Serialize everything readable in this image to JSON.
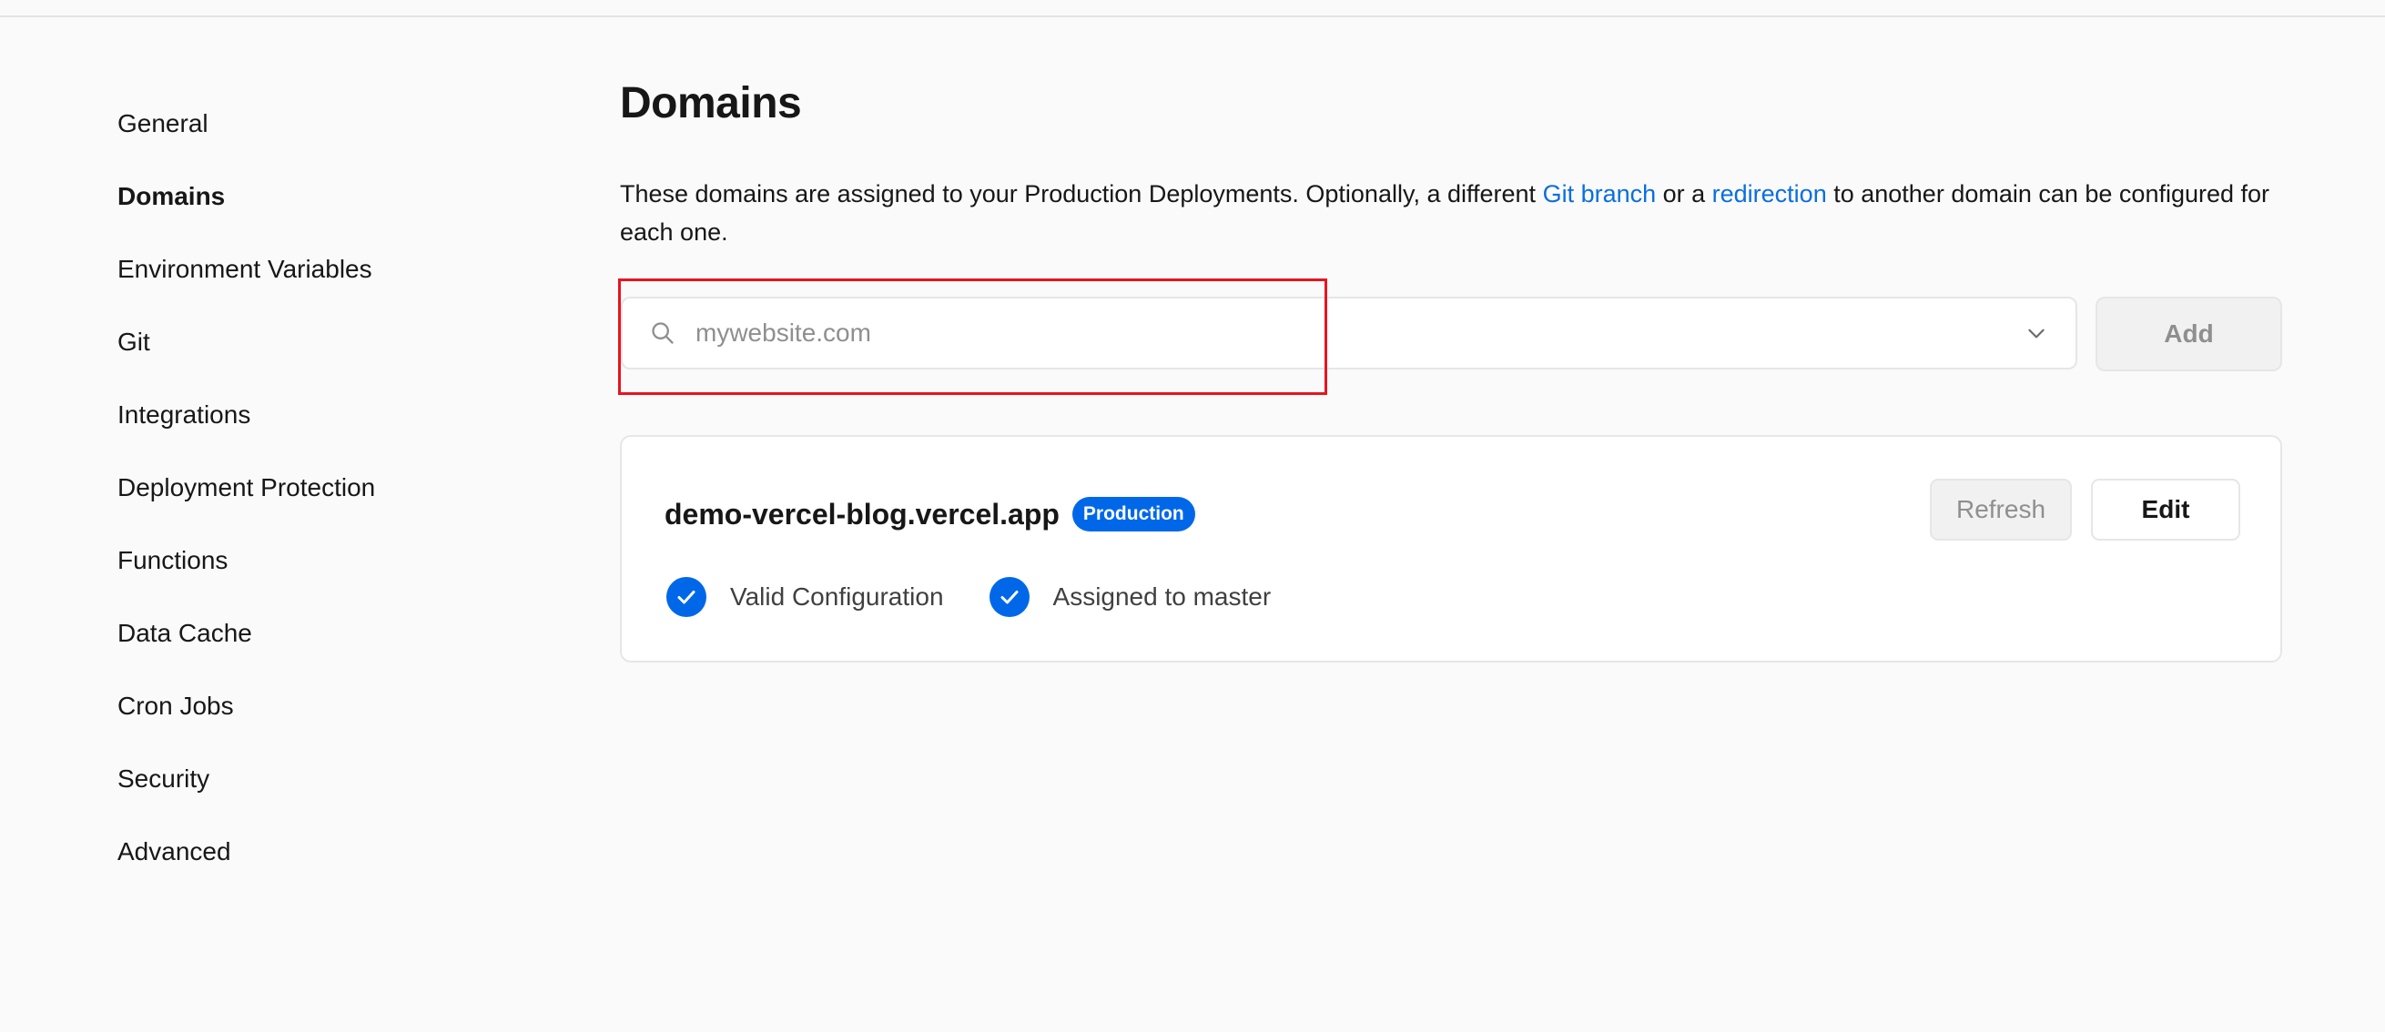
{
  "sidebar": {
    "items": [
      {
        "label": "General"
      },
      {
        "label": "Domains"
      },
      {
        "label": "Environment Variables"
      },
      {
        "label": "Git"
      },
      {
        "label": "Integrations"
      },
      {
        "label": "Deployment Protection"
      },
      {
        "label": "Functions"
      },
      {
        "label": "Data Cache"
      },
      {
        "label": "Cron Jobs"
      },
      {
        "label": "Security"
      },
      {
        "label": "Advanced"
      }
    ],
    "active_item": "Domains"
  },
  "main": {
    "title": "Domains",
    "description": {
      "part1": "These domains are assigned to your Production Deployments. Optionally, a different ",
      "link1": "Git branch",
      "part2": " or a ",
      "link2": "redirection",
      "part3": " to another domain can be configured for each one."
    },
    "domain_input": {
      "placeholder": "mywebsite.com",
      "value": "",
      "search_icon": "search-icon",
      "dropdown_icon": "chevron-down-icon"
    },
    "add_button_label": "Add",
    "domain_card": {
      "domain": "demo-vercel-blog.vercel.app",
      "badge": "Production",
      "statuses": [
        {
          "label": "Valid Configuration",
          "icon": "check-circle-icon"
        },
        {
          "label": "Assigned to master",
          "icon": "check-circle-icon"
        }
      ],
      "refresh_label": "Refresh",
      "edit_label": "Edit"
    }
  },
  "colors": {
    "background": "#fafafa",
    "accent": "#0068e8",
    "link": "#0a6ee0",
    "highlight": "#e8141e"
  }
}
